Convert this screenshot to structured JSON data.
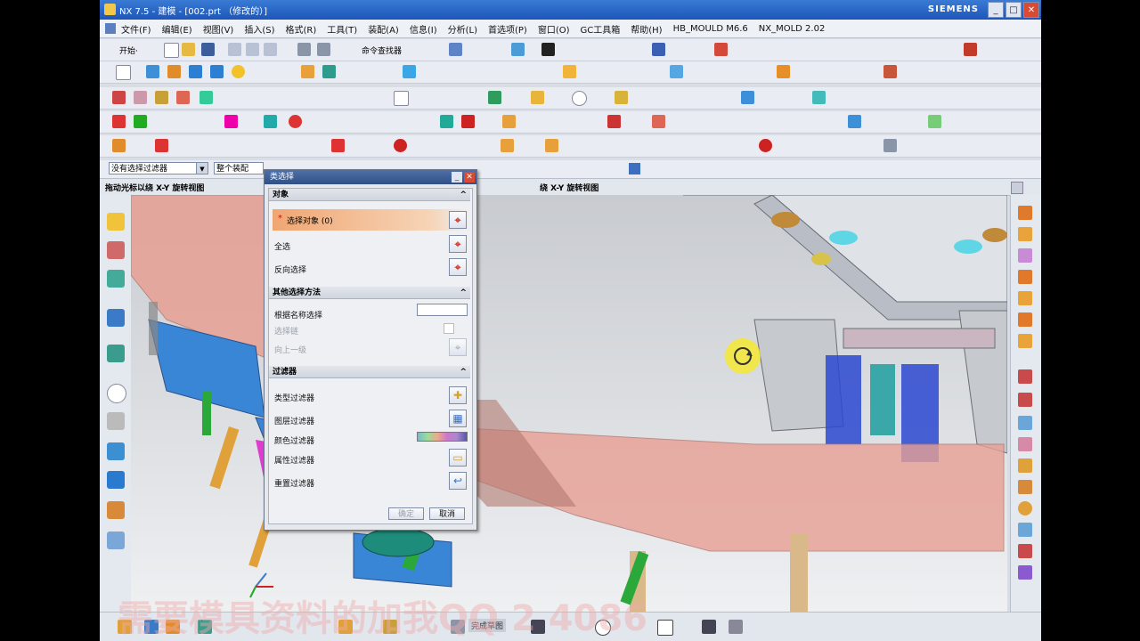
{
  "window": {
    "title": "NX 7.5 - 建模 - [002.prt （修改的）]",
    "brand": "SIEMENS",
    "min": "_",
    "max": "□",
    "close": "✕"
  },
  "menu": [
    "文件(F)",
    "编辑(E)",
    "视图(V)",
    "插入(S)",
    "格式(R)",
    "工具(T)",
    "装配(A)",
    "信息(I)",
    "分析(L)",
    "首选项(P)",
    "窗口(O)",
    "GC工具箱",
    "帮助(H)",
    "HB_MOULD M6.6",
    "NX_MOLD 2.02"
  ],
  "toolbar": {
    "start_label": "开始·",
    "command_finder_label": "命令查找器"
  },
  "filterbar": {
    "type_filter": "没有选择过滤器",
    "scope": "整个装配"
  },
  "hints": {
    "left": "拖动光标以绕 X-Y 旋转视图",
    "right": "绕 X-Y 旋转视图"
  },
  "dialog": {
    "title": "类选择",
    "sections": {
      "objects": "对象",
      "other_methods": "其他选择方法",
      "filters": "过滤器"
    },
    "rows": {
      "select_object": "选择对象 (0)",
      "select_all": "全选",
      "invert": "反向选择",
      "by_name": "根据名称选择",
      "select_chain": "选择链",
      "up_level": "向上一级",
      "type_filter": "类型过滤器",
      "layer_filter": "图层过滤器",
      "color_filter": "颜色过滤器",
      "attribute_filter": "属性过滤器",
      "reset_filter": "重置过滤器"
    },
    "ok": "确定",
    "cancel": "取消"
  },
  "bottom": {
    "sketch_label": "完成草图"
  },
  "watermark": "需要模具资料的加我QQ 2  4086"
}
